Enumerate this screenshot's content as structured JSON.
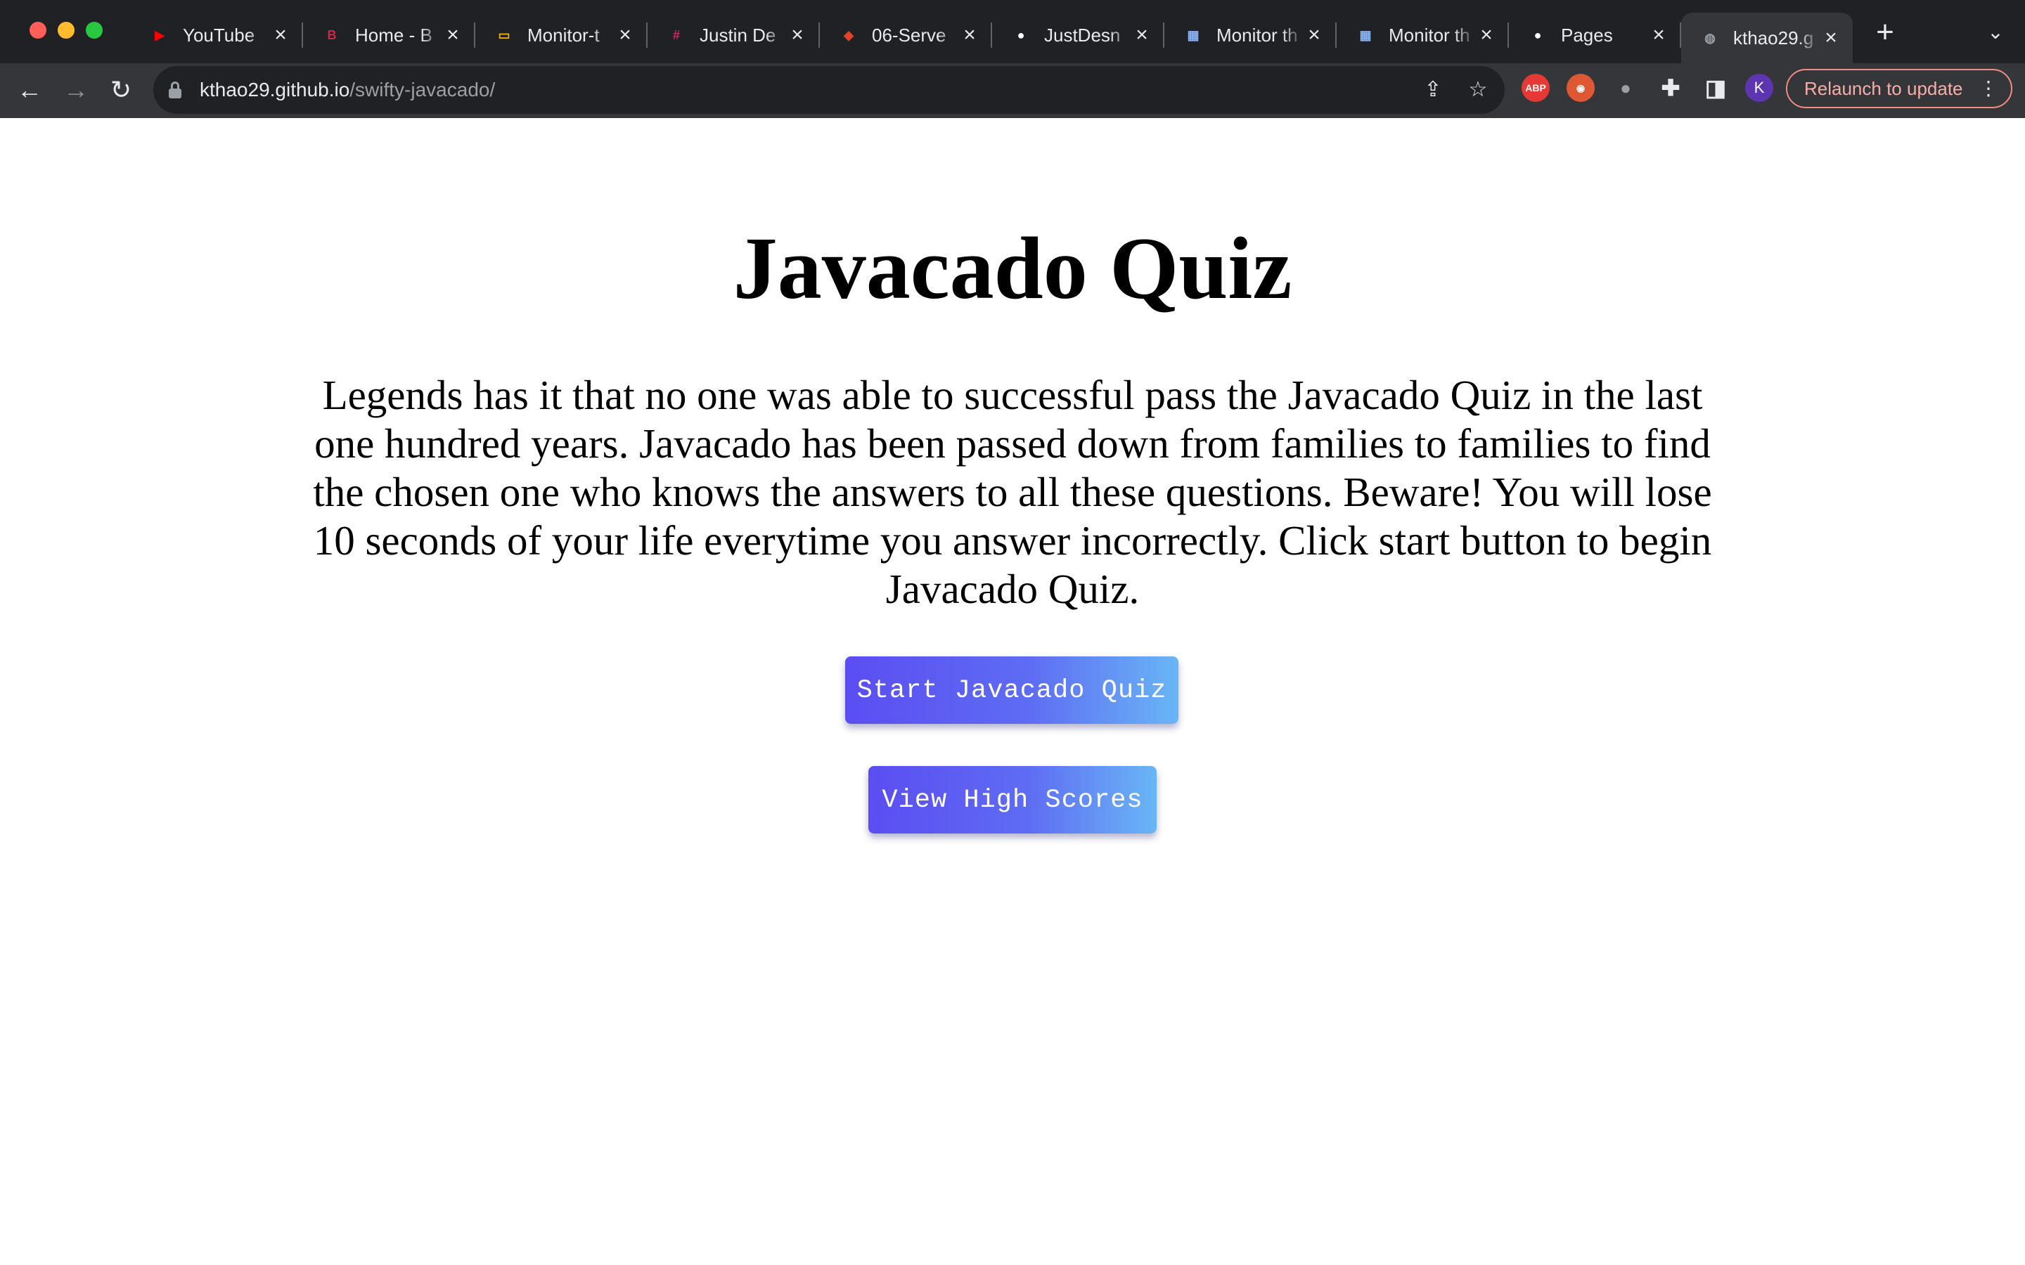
{
  "browser": {
    "tabs": [
      {
        "title": "YouTube",
        "icon": "youtube-icon",
        "color": "#ff0000",
        "glyph": "▶"
      },
      {
        "title": "Home - B",
        "icon": "bootcamp-icon",
        "color": "#c42b4b",
        "glyph": "B"
      },
      {
        "title": "Monitor-t",
        "icon": "slides-icon",
        "color": "#f4b400",
        "glyph": "▭"
      },
      {
        "title": "Justin De",
        "icon": "slack-icon",
        "color": "#e01e5a",
        "glyph": "#"
      },
      {
        "title": "06-Serve",
        "icon": "gitlab-icon",
        "color": "#e24329",
        "glyph": "◆"
      },
      {
        "title": "JustDesn",
        "icon": "github-icon",
        "color": "#ffffff",
        "glyph": "●"
      },
      {
        "title": "Monitor th",
        "icon": "monitor-screenshot-icon",
        "color": "#8ab4f8",
        "glyph": "▦"
      },
      {
        "title": "Monitor th",
        "icon": "monitor-screenshot-icon",
        "color": "#8ab4f8",
        "glyph": "▦"
      },
      {
        "title": "Pages",
        "icon": "github-icon",
        "color": "#ffffff",
        "glyph": "●"
      },
      {
        "title": "kthao29.g",
        "icon": "globe-icon",
        "color": "#9aa0a6",
        "glyph": "◍",
        "active": true
      }
    ],
    "address": {
      "host": "kthao29.github.io",
      "path": "/swifty-javacado/"
    },
    "relaunch_label": "Relaunch to update",
    "avatar_letter": "K",
    "abp_label": "ABP"
  },
  "page": {
    "title": "Javacado Quiz",
    "intro": "Legends has it that no one was able to successful pass the Javacado Quiz in the last one hundred years. Javacado has been passed down from families to families to find the chosen one who knows the answers to all these questions. Beware! You will lose 10 seconds of your life everytime you answer incorrectly. Click start button to begin Javacado Quiz.",
    "start_button": "Start Javacado Quiz",
    "scores_button": "View High Scores"
  }
}
